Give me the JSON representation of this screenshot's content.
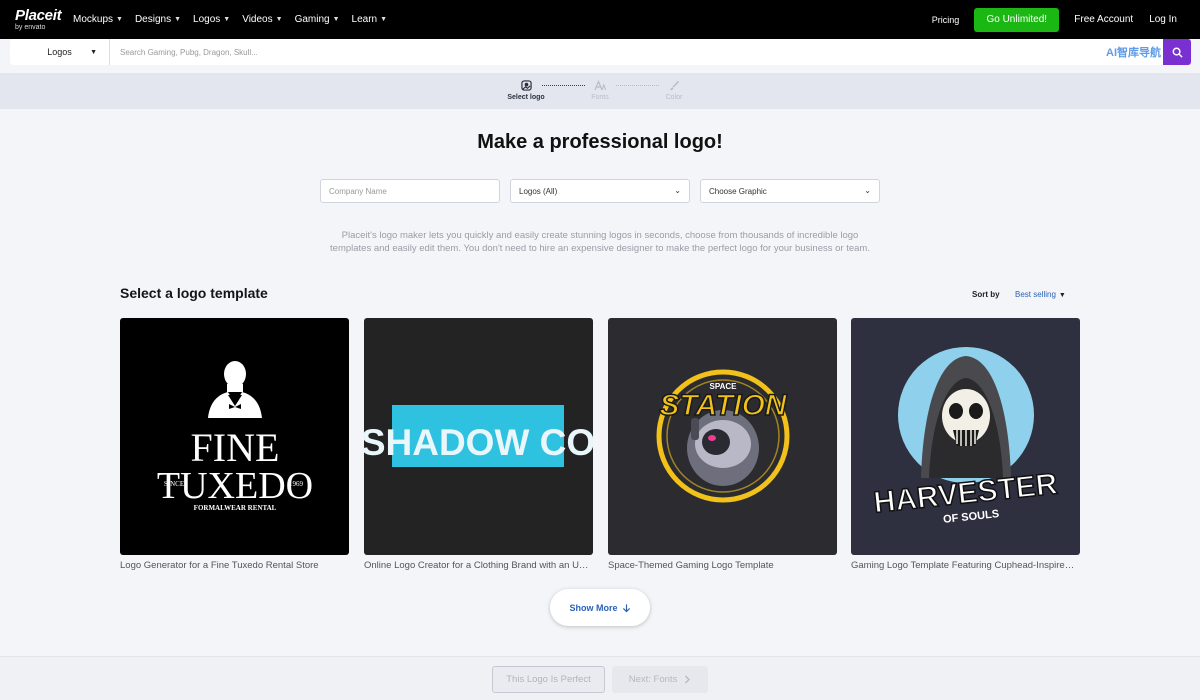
{
  "nav": {
    "logo_text": "Placeit",
    "logo_sub": "by envato",
    "links": [
      "Mockups",
      "Designs",
      "Logos",
      "Videos",
      "Gaming",
      "Learn"
    ],
    "pricing": "Pricing",
    "go_unlimited": "Go Unlimited!",
    "free_account": "Free Account",
    "login": "Log In"
  },
  "search": {
    "category": "Logos",
    "placeholder": "Search Gaming, Pubg, Dragon, Skull..."
  },
  "watermark": "AI智库导航",
  "steps": [
    {
      "label": "Select logo",
      "active": true
    },
    {
      "label": "Fonts",
      "active": false
    },
    {
      "label": "Color",
      "active": false
    }
  ],
  "headline": "Make a professional logo!",
  "filters": {
    "company_placeholder": "Company Name",
    "type": "Logos (All)",
    "graphic": "Choose Graphic"
  },
  "description": "Placeit's logo maker lets you quickly and easily create stunning logos in seconds, choose from thousands of incredible logo templates and easily edit them. You don't need to hire an expensive designer to make the perfect logo for your business or team.",
  "section_title": "Select a logo template",
  "sort": {
    "label": "Sort by",
    "value": "Best selling"
  },
  "cards": [
    {
      "caption": "Logo Generator for a Fine Tuxedo Rental Store",
      "art": {
        "line1": "FINE",
        "line2": "TUXEDO",
        "since": "SINCE",
        "year": "1969",
        "tagline": "FORMALWEAR RENTAL"
      }
    },
    {
      "caption": "Online Logo Creator for a Clothing Brand with an U…",
      "art": {
        "text": "SHADOW CO"
      }
    },
    {
      "caption": "Space-Themed Gaming Logo Template",
      "art": {
        "top": "SPACE",
        "main": "STATION"
      }
    },
    {
      "caption": "Gaming Logo Template Featuring Cuphead-Inspire…",
      "art": {
        "main": "HARVESTER",
        "sub": "OF SOULS"
      }
    }
  ],
  "show_more": "Show More",
  "footer": {
    "perfect": "This Logo Is Perfect",
    "next": "Next: Fonts"
  }
}
